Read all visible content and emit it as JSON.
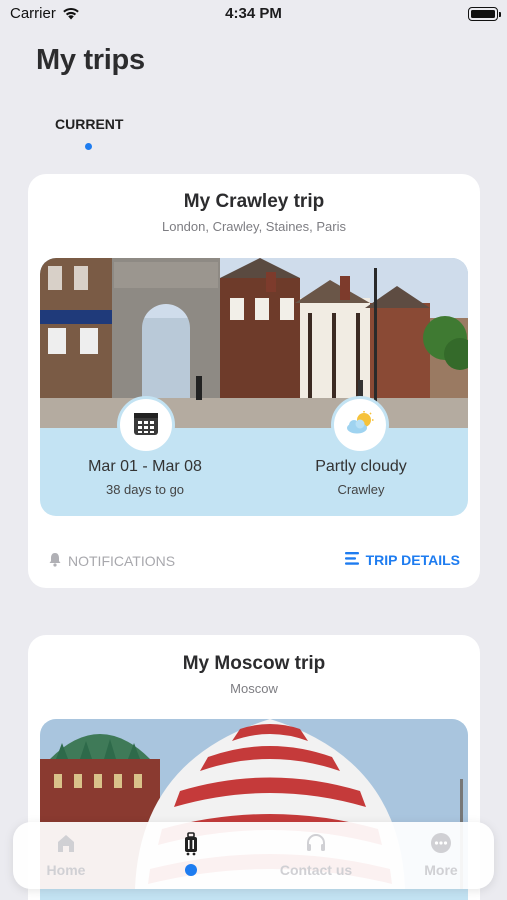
{
  "status_bar": {
    "carrier": "Carrier",
    "time": "4:34 PM"
  },
  "page": {
    "title": "My trips"
  },
  "tabs": {
    "current_label": "CURRENT"
  },
  "trips": [
    {
      "title": "My Crawley trip",
      "cities": "London, Crawley, Staines, Paris",
      "dates": "Mar 01 - Mar 08",
      "countdown": "38 days to go",
      "weather": "Partly cloudy",
      "weather_city": "Crawley",
      "notifications_label": "NOTIFICATIONS",
      "details_label": "TRIP DETAILS"
    },
    {
      "title": "My Moscow trip",
      "cities": "Moscow"
    }
  ],
  "tabbar": {
    "items": [
      {
        "label": "Home",
        "icon": "home-icon"
      },
      {
        "label": "",
        "icon": "luggage-icon",
        "active": true
      },
      {
        "label": "Contact us",
        "icon": "headset-icon"
      },
      {
        "label": "More",
        "icon": "more-icon"
      }
    ]
  },
  "colors": {
    "accent": "#1e7cf0",
    "panel": "#c3e3f3",
    "background": "#ebebf0"
  }
}
